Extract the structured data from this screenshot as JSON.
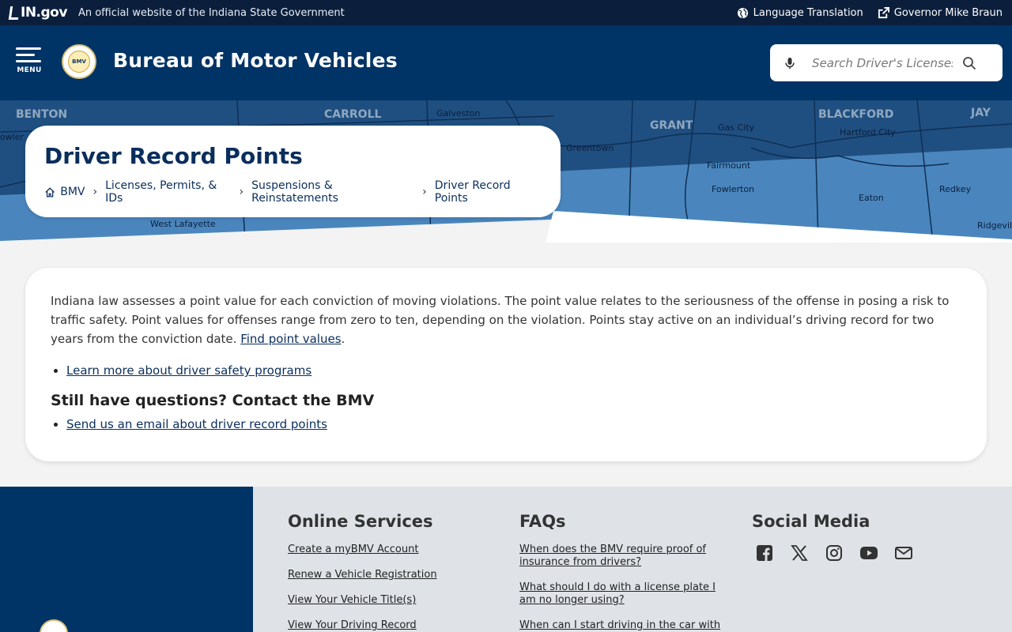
{
  "topbar": {
    "logo_text": "IN.gov",
    "official_text": "An official website of the Indiana State Government",
    "language_label": "Language Translation",
    "governor_label": "Governor Mike Braun"
  },
  "header": {
    "menu_label": "MENU",
    "seal_text": "BMV",
    "site_title": "Bureau of Motor Vehicles",
    "search_placeholder": "Search Driver's Licenses"
  },
  "hero": {
    "page_title": "Driver Record Points",
    "breadcrumb": [
      "BMV",
      "Licenses, Permits, & IDs",
      "Suspensions & Reinstatements",
      "Driver Record Points"
    ],
    "map_labels": [
      "BENTON",
      "CARROLL",
      "GRANT",
      "BLACKFORD",
      "JAY",
      "Galveston",
      "Gas City",
      "Hartford City",
      "Greentown",
      "Fairmount",
      "Fowlerton",
      "Eaton",
      "Redkey",
      "Ridgeville",
      "West Lafayette",
      "owler"
    ]
  },
  "content": {
    "intro_text": "Indiana law assesses a point value for each conviction of moving violations. The point value relates to the seriousness of the offense in posing a risk to traffic safety. Point values for offenses range from zero to ten, depending on the violation. Points stay active on an individual’s driving record for two years from the conviction date. ",
    "find_link": "Find point values",
    "period": ".",
    "safety_link": "Learn more about driver safety programs",
    "questions_heading": "Still have questions? Contact the BMV",
    "email_link": "Send us an email about driver record points"
  },
  "footer": {
    "online_heading": "Online Services",
    "online_links": [
      "Create a myBMV Account",
      "Renew a Vehicle Registration",
      "View Your Vehicle Title(s)",
      "View Your Driving Record"
    ],
    "faq_heading": "FAQs",
    "faq_links": [
      "When does the BMV require proof of insurance from drivers?",
      "What should I do with a license plate I am no longer using?",
      "When can I start driving in the car with"
    ],
    "social_heading": "Social Media",
    "social_icons": [
      "facebook-icon",
      "x-icon",
      "instagram-icon",
      "youtube-icon",
      "email-icon"
    ]
  },
  "colors": {
    "navy": "#003366",
    "topbar": "#0b1f3d",
    "link": "#0a2e5c",
    "footer_gray": "#dfe3e8"
  }
}
